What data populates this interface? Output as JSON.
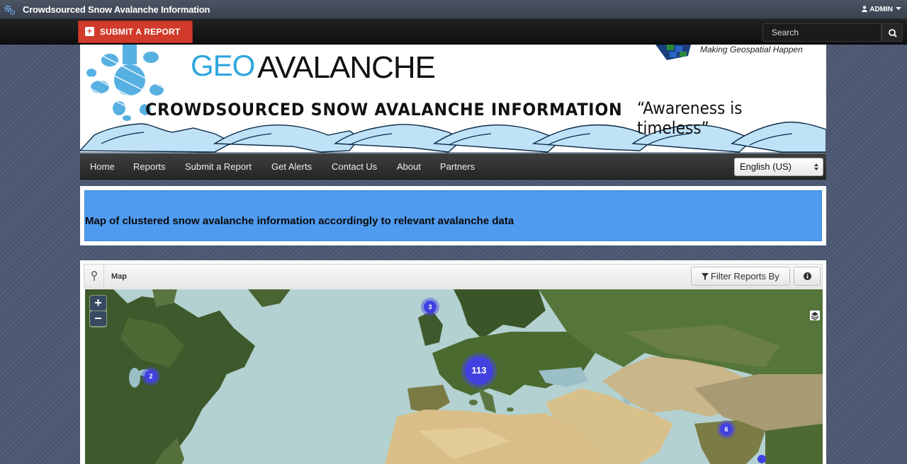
{
  "topbar": {
    "site_title": "Crowdsourced Snow Avalanche Information",
    "admin_label": "ADMIN"
  },
  "toolbar": {
    "submit_label": "SUBMIT A REPORT",
    "search_placeholder": "Search"
  },
  "banner": {
    "logo_geo": "GEO",
    "logo_avalanche": "AVALANCHE",
    "subtitle": "CROWDSOURCED SNOW AVALANCHE INFORMATION",
    "tagline": "“Awareness is timeless”",
    "sponsor_text": "Making Geospatial Happen"
  },
  "nav": {
    "items": [
      {
        "label": "Home"
      },
      {
        "label": "Reports"
      },
      {
        "label": "Submit a Report"
      },
      {
        "label": "Get Alerts"
      },
      {
        "label": "Contact Us"
      },
      {
        "label": "About"
      },
      {
        "label": "Partners"
      }
    ],
    "language": "English (US)"
  },
  "info": {
    "text": "Map of clustered snow avalanche information accordingly to relevant avalanche data"
  },
  "map": {
    "title": "Map",
    "filter_label": "Filter Reports By",
    "zoom_in": "+",
    "zoom_out": "−",
    "clusters": [
      {
        "count": "3"
      },
      {
        "count": "2"
      },
      {
        "count": "113"
      },
      {
        "count": "6"
      }
    ]
  },
  "colors": {
    "accent_red": "#d13b2b",
    "info_blue": "#4f9bf0",
    "cluster_blue": "#4141e0"
  }
}
